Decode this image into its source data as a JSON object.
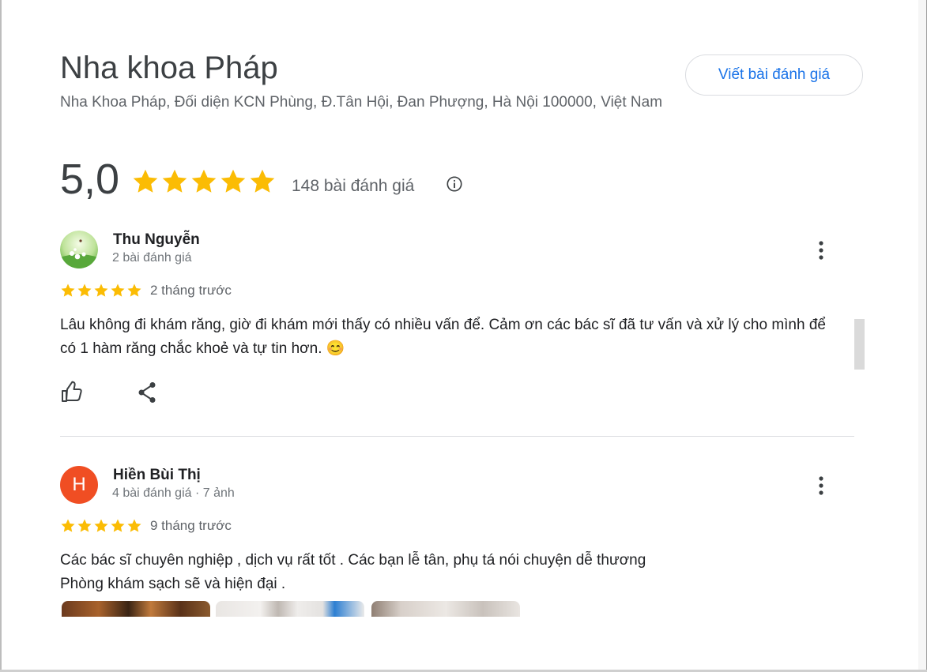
{
  "place": {
    "title": "Nha khoa Pháp",
    "address": "Nha Khoa Pháp, Đối diện KCN Phùng, Đ.Tân Hội, Đan Phượng, Hà Nội 100000, Việt Nam",
    "write_review_label": "Viết bài đánh giá"
  },
  "rating": {
    "value": "5,0",
    "stars": 5,
    "count_label": "148 bài đánh giá",
    "star_color": "#fbbc04"
  },
  "reviews": [
    {
      "name": "Thu Nguyễn",
      "meta": "2 bài đánh giá",
      "stars": 5,
      "time": "2 tháng trước",
      "text": "Lâu không đi khám răng, giờ đi khám mới thấy có nhiều vấn để. Cảm ơn các bác sĩ đã tư vấn và xử lý cho mình để có 1 hàm răng chắc khoẻ và tự tin hơn. 😊"
    },
    {
      "name": "Hiền Bùi Thị",
      "avatar_letter": "H",
      "avatar_color": "#f04e23",
      "meta": "4 bài đánh giá · 7 ảnh",
      "stars": 5,
      "time": "9 tháng trước",
      "text_line1": "Các bác sĩ chuyên nghiệp , dịch vụ rất tốt . Các bạn lễ tân, phụ tá nói chuyện dễ thương",
      "text_line2": "Phòng khám sạch sẽ và hiện đại ."
    }
  ],
  "colors": {
    "accent": "#1a73e8",
    "text": "#202124",
    "muted": "#5f6368"
  }
}
